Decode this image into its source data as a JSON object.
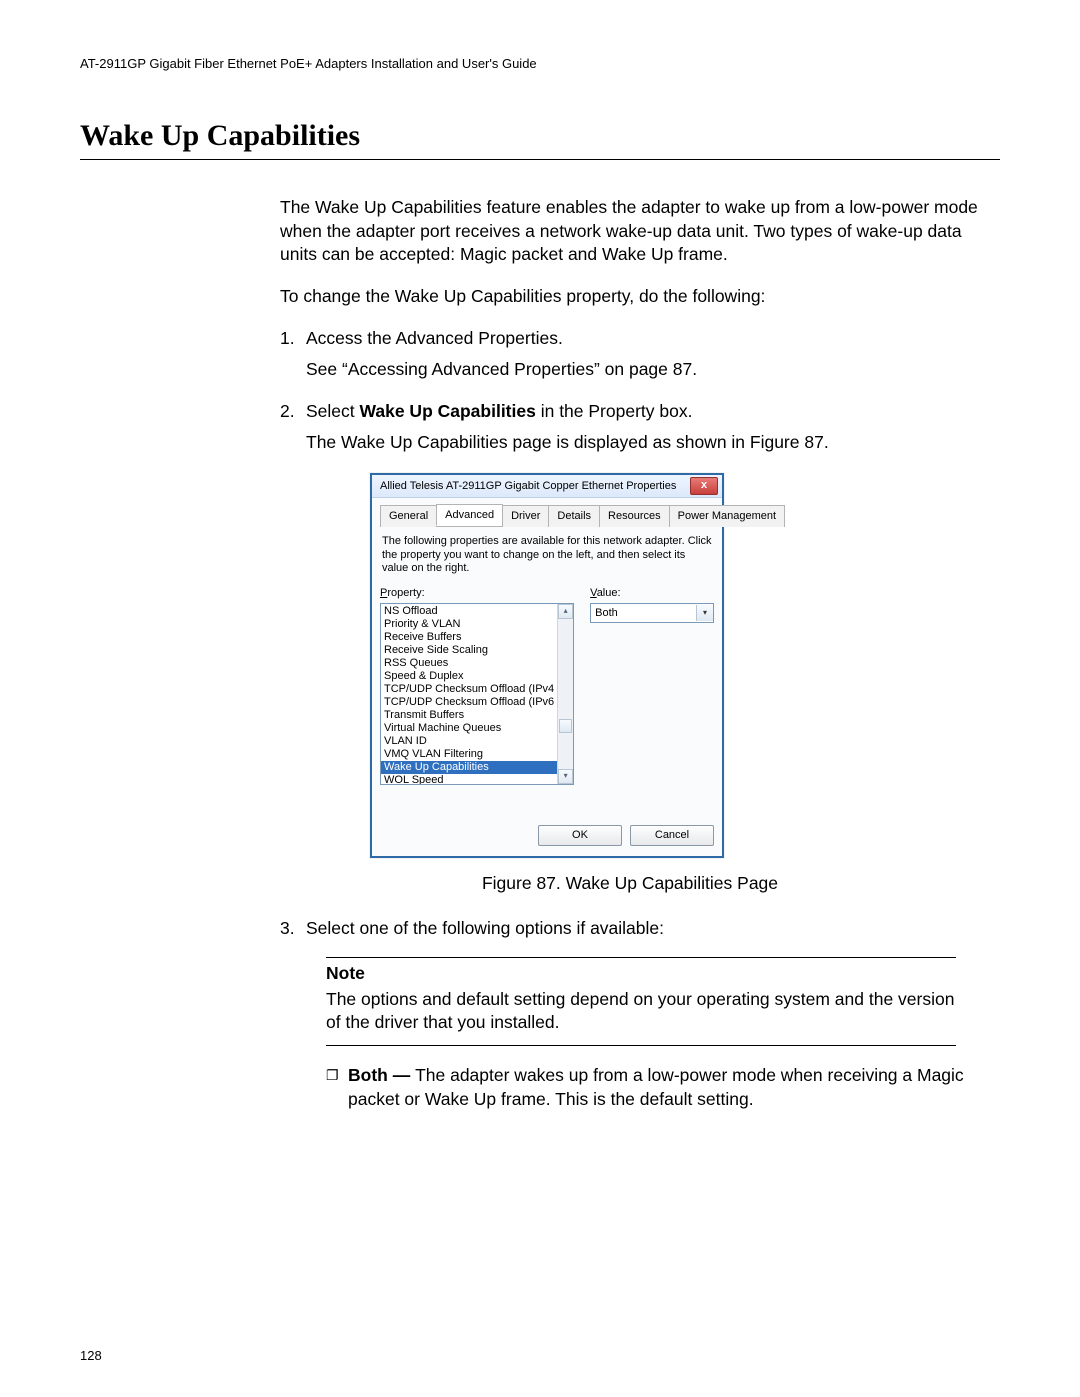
{
  "header": {
    "doc_title": "AT-2911GP Gigabit Fiber Ethernet PoE+ Adapters Installation and User's Guide"
  },
  "section": {
    "title": "Wake Up Capabilities"
  },
  "intro": {
    "p1": "The Wake Up Capabilities feature enables the adapter to wake up from a low-power mode when the adapter port receives a network wake-up data unit. Two types of wake-up data units can be accepted: Magic packet and Wake Up frame.",
    "p2": "To change the Wake Up Capabilities property, do the following:"
  },
  "steps": {
    "s1": {
      "num": "1.",
      "text": "Access the Advanced Properties.",
      "sub": "See “Accessing Advanced Properties” on page 87."
    },
    "s2": {
      "num": "2.",
      "text_pre": "Select ",
      "text_bold": "Wake Up Capabilities",
      "text_post": " in the Property box.",
      "sub": "The Wake Up Capabilities page is displayed as shown in Figure 87."
    },
    "s3": {
      "num": "3.",
      "text": "Select one of the following options if available:"
    }
  },
  "dialog": {
    "title": "Allied Telesis AT-2911GP Gigabit Copper Ethernet Properties",
    "close": "x",
    "tabs": {
      "t0": "General",
      "t1": "Advanced",
      "t2": "Driver",
      "t3": "Details",
      "t4": "Resources",
      "t5": "Power Management"
    },
    "desc": "The following properties are available for this network adapter. Click the property you want to change on the left, and then select its value on the right.",
    "property_label_u": "P",
    "property_label_rest": "roperty:",
    "value_label_u": "V",
    "value_label_rest": "alue:",
    "props": {
      "p0": "NS Offload",
      "p1": "Priority & VLAN",
      "p2": "Receive Buffers",
      "p3": "Receive Side Scaling",
      "p4": "RSS Queues",
      "p5": "Speed & Duplex",
      "p6": "TCP/UDP Checksum Offload (IPv4",
      "p7": "TCP/UDP Checksum Offload (IPv6",
      "p8": "Transmit Buffers",
      "p9": "Virtual Machine Queues",
      "p10": "VLAN ID",
      "p11": "VMQ VLAN Filtering",
      "p12": "Wake Up Capabilities",
      "p13": "WOL Speed"
    },
    "value": "Both",
    "ok": "OK",
    "cancel": "Cancel"
  },
  "figure": {
    "caption": "Figure 87. Wake Up Capabilities Page"
  },
  "note": {
    "label": "Note",
    "text": "The options and default setting depend on your operating system and the version of the driver that you installed."
  },
  "bullet": {
    "bold": "Both — ",
    "text": "The adapter wakes up from a low-power mode when receiving a Magic packet or Wake Up frame. This is the default setting."
  },
  "page": {
    "num": "128"
  }
}
